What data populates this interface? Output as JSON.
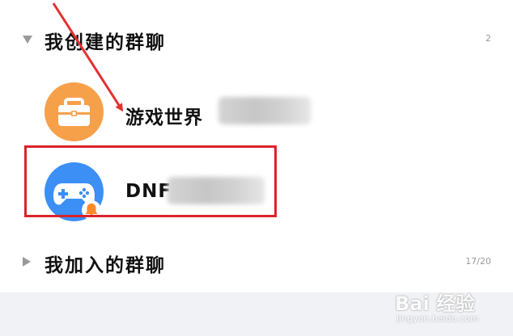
{
  "sections": {
    "created": {
      "title": "我创建的群聊",
      "count": "2"
    },
    "joined": {
      "title": "我加入的群聊",
      "count": "17/20"
    }
  },
  "groups": [
    {
      "name": "游戏世界",
      "icon": "briefcase-icon",
      "color": "#f7a04a"
    },
    {
      "name": "DNF",
      "icon": "gamepad-icon",
      "color": "#3b8ff5",
      "badge": "bell-muted-icon"
    }
  ],
  "watermark": {
    "logo": "Bai 经验",
    "url": "jingyan.baidu.com"
  },
  "colors": {
    "highlight": "#d9232a",
    "arrow": "#e53030"
  }
}
